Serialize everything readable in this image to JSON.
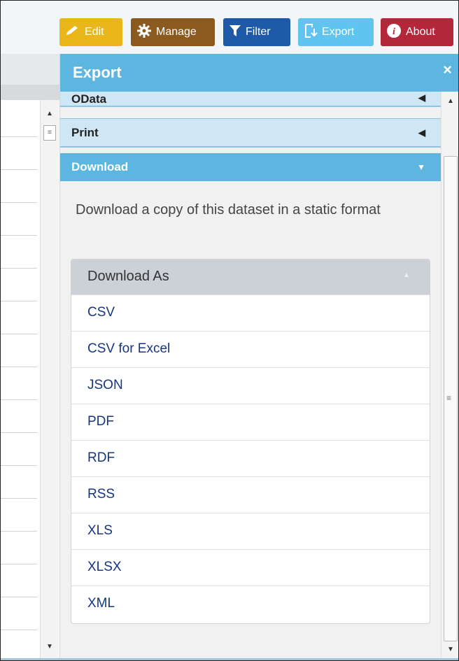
{
  "toolbar": {
    "edit": {
      "label": "Edit",
      "icon": "pencil-icon",
      "color": "#eab71b"
    },
    "manage": {
      "label": "Manage",
      "icon": "gear-icon",
      "color": "#8a5a1f"
    },
    "filter": {
      "label": "Filter",
      "icon": "funnel-icon",
      "color": "#1e5aa8"
    },
    "export": {
      "label": "Export",
      "icon": "export-icon",
      "color": "#5fc5ef"
    },
    "about": {
      "label": "About",
      "icon": "info-icon",
      "color": "#b4263a"
    }
  },
  "panel": {
    "title": "Export",
    "close_glyph": "×",
    "sections": {
      "odata": {
        "label": "OData",
        "state": "collapsed"
      },
      "print": {
        "label": "Print",
        "state": "collapsed"
      },
      "download": {
        "label": "Download",
        "state": "expanded"
      }
    },
    "download": {
      "description": "Download a copy of this dataset in a static format",
      "header": "Download As",
      "options": [
        "CSV",
        "CSV for Excel",
        "JSON",
        "PDF",
        "RDF",
        "RSS",
        "XLS",
        "XLSX",
        "XML"
      ]
    }
  },
  "colors": {
    "accent": "#5cb6df",
    "option_link": "#16367e"
  }
}
